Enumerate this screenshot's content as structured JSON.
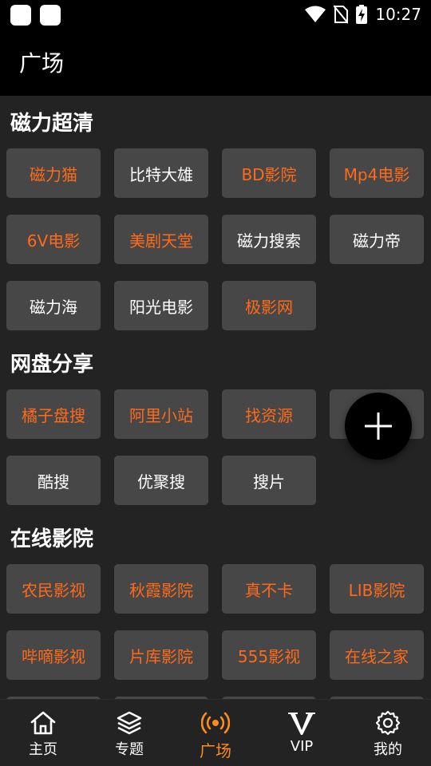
{
  "status_bar": {
    "time": "10:27"
  },
  "app_bar": {
    "title": "广场"
  },
  "sections": [
    {
      "title": "磁力超清",
      "items": [
        {
          "label": "磁力猫",
          "color": "orange"
        },
        {
          "label": "比特大雄",
          "color": "white"
        },
        {
          "label": "BD影院",
          "color": "orange"
        },
        {
          "label": "Mp4电影",
          "color": "orange"
        },
        {
          "label": "6V电影",
          "color": "orange"
        },
        {
          "label": "美剧天堂",
          "color": "orange"
        },
        {
          "label": "磁力搜索",
          "color": "white"
        },
        {
          "label": "磁力帝",
          "color": "white"
        },
        {
          "label": "磁力海",
          "color": "white"
        },
        {
          "label": "阳光电影",
          "color": "white"
        },
        {
          "label": "极影网",
          "color": "orange"
        }
      ]
    },
    {
      "title": "网盘分享",
      "items": [
        {
          "label": "橘子盘搜",
          "color": "orange"
        },
        {
          "label": "阿里小站",
          "color": "orange"
        },
        {
          "label": "找资源",
          "color": "orange"
        },
        {
          "label": "",
          "color": "orange"
        },
        {
          "label": "酷搜",
          "color": "white"
        },
        {
          "label": "优聚搜",
          "color": "white"
        },
        {
          "label": "搜片",
          "color": "white"
        }
      ]
    },
    {
      "title": "在线影院",
      "items": [
        {
          "label": "农民影视",
          "color": "orange"
        },
        {
          "label": "秋霞影院",
          "color": "orange"
        },
        {
          "label": "真不卡",
          "color": "orange"
        },
        {
          "label": "LIB影院",
          "color": "orange"
        },
        {
          "label": "哔嘀影视",
          "color": "orange"
        },
        {
          "label": "片库影院",
          "color": "orange"
        },
        {
          "label": "555影视",
          "color": "orange"
        },
        {
          "label": "在线之家",
          "color": "orange"
        }
      ]
    }
  ],
  "bottom_nav": [
    {
      "label": "主页",
      "icon": "home-icon",
      "active": false
    },
    {
      "label": "专题",
      "icon": "layers-icon",
      "active": false
    },
    {
      "label": "广场",
      "icon": "broadcast-icon",
      "active": true
    },
    {
      "label": "VIP",
      "icon": "vip-icon",
      "active": false
    },
    {
      "label": "我的",
      "icon": "gear-icon",
      "active": false
    }
  ],
  "colors": {
    "accent": "#ff6a1a",
    "nav_active": "#ff8c1a",
    "tile_bg": "#474747",
    "page_bg": "#232323"
  }
}
